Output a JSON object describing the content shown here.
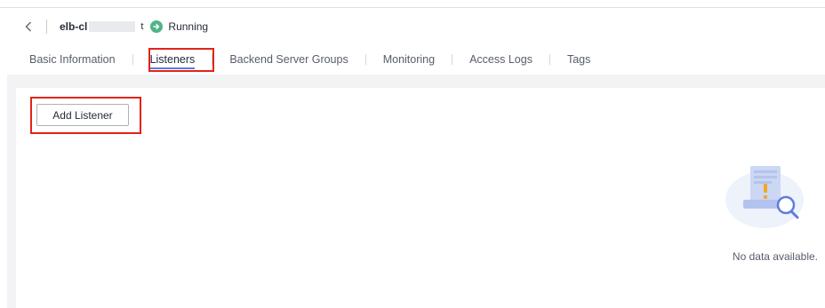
{
  "header": {
    "back_icon": "chevron-left-icon",
    "lb_name_prefix": "elb-cl",
    "lb_name_suffix": "t",
    "status_icon": "arrow-right-circle-icon",
    "status": "Running",
    "status_color": "#50b487"
  },
  "tabs": [
    {
      "label": "Basic Information",
      "active": false
    },
    {
      "label": "Listeners",
      "active": true
    },
    {
      "label": "Backend Server Groups",
      "active": false
    },
    {
      "label": "Monitoring",
      "active": false
    },
    {
      "label": "Access Logs",
      "active": false
    },
    {
      "label": "Tags",
      "active": false
    }
  ],
  "toolbar": {
    "add_listener_label": "Add Listener"
  },
  "empty_state": {
    "icon": "document-search-icon",
    "message": "No data available."
  },
  "colors": {
    "accent": "#5e7ce0",
    "highlight": "#e2231a",
    "content_bg": "#f2f3f5"
  }
}
